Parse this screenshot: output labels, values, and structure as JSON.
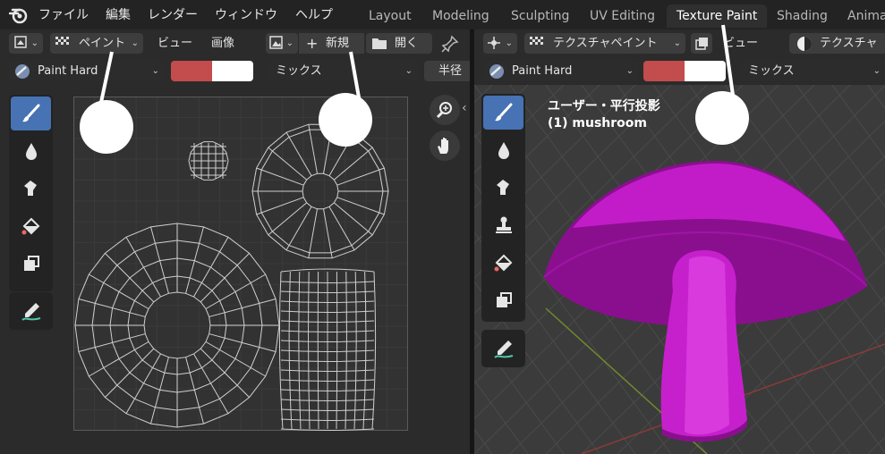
{
  "menubar": {
    "items": [
      "ファイル",
      "編集",
      "レンダー",
      "ウィンドウ",
      "ヘルプ"
    ],
    "workspaces": [
      "Layout",
      "Modeling",
      "Sculpting",
      "UV Editing",
      "Texture Paint",
      "Shading",
      "Anima"
    ],
    "active_workspace": "Texture Paint"
  },
  "image_editor": {
    "mode": "ペイント",
    "view": "ビュー",
    "image": "画像",
    "new": "新規",
    "open": "開く",
    "brush": "Paint Hard",
    "blend": "ミックス",
    "radius": "半径",
    "color": "#c34c4c",
    "secondary_color": "#ffffff"
  },
  "viewport": {
    "mode": "テクスチャペイント",
    "view": "ビュー",
    "shading_label": "テクスチャ",
    "brush": "Paint Hard",
    "blend": "ミックス",
    "color": "#c34c4c",
    "overlay_line1": "ユーザー・平行投影",
    "overlay_line2": "(1) mushroom"
  }
}
